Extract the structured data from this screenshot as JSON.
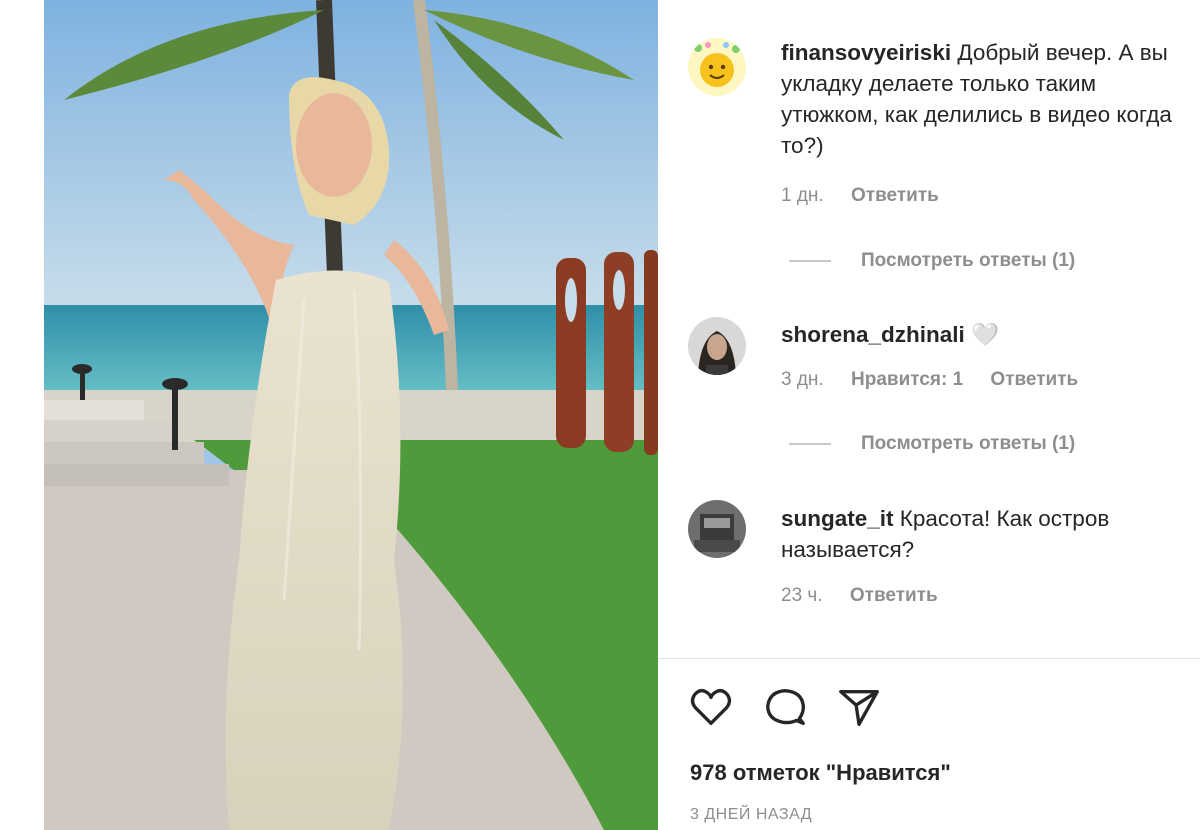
{
  "post": {
    "media_alt_icon": "video-frame"
  },
  "comments": [
    {
      "username": "finansovyeiriski",
      "text": "Добрый вечер. А вы укладку делаете только таким утюжком, как делились в видео когда то?)",
      "time": "1 дн.",
      "reply_label": "Ответить",
      "view_replies": "Посмотреть ответы (1)"
    },
    {
      "username": "shorena_dzhinali",
      "text": "🤍",
      "time": "3 дн.",
      "likes_label": "Нравится: 1",
      "reply_label": "Ответить",
      "view_replies": "Посмотреть ответы (1)"
    },
    {
      "username": "sungate_it",
      "text": "Красота! Как остров называется?",
      "time": "23 ч.",
      "reply_label": "Ответить"
    }
  ],
  "footer": {
    "likes": "978 отметок \"Нравится\"",
    "date": "3 ДНЕЙ НАЗАД"
  },
  "colors": {
    "text": "#262626",
    "muted": "#8e8e8e",
    "sky": "#9fc6e8",
    "sea": "#4aa7b8",
    "grass": "#4f9a3a"
  }
}
